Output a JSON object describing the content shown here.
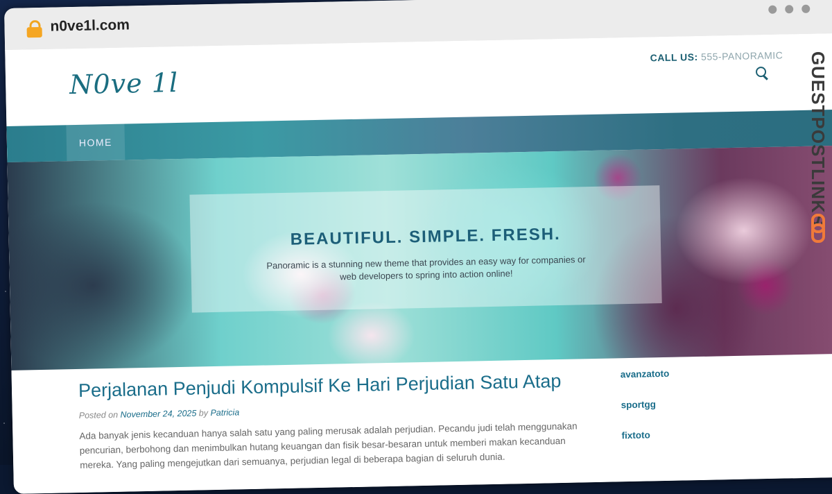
{
  "browser": {
    "url": "n0ve1l.com"
  },
  "site": {
    "logo": "N0ve 1l",
    "call_label": "CALL US:",
    "call_number": "555-PANORAMIC",
    "nav": {
      "home": "HOME"
    }
  },
  "hero": {
    "title": "BEAUTIFUL. SIMPLE. FRESH.",
    "subtitle": "Panoramic is a stunning new theme that provides an easy way for companies or web developers to spring into action online!"
  },
  "post": {
    "title": "Perjalanan Penjudi Kompulsif Ke Hari Perjudian Satu Atap",
    "posted_on": "Posted on",
    "date": "November 24, 2025",
    "by": "by",
    "author": "Patricia",
    "body": "Ada banyak jenis kecanduan hanya salah satu yang paling merusak adalah perjudian. Pecandu judi telah menggunakan pencurian, berbohong dan menimbulkan hutang keuangan dan fisik besar-besaran untuk memberi makan kecanduan mereka. Yang paling mengejutkan dari semuanya, perjudian legal di beberapa bagian di seluruh dunia."
  },
  "sidebar": {
    "links": [
      "avanzatoto",
      "sportgg",
      "fixtoto"
    ]
  },
  "watermark": {
    "text": "GUESTPOSTLINKS"
  }
}
